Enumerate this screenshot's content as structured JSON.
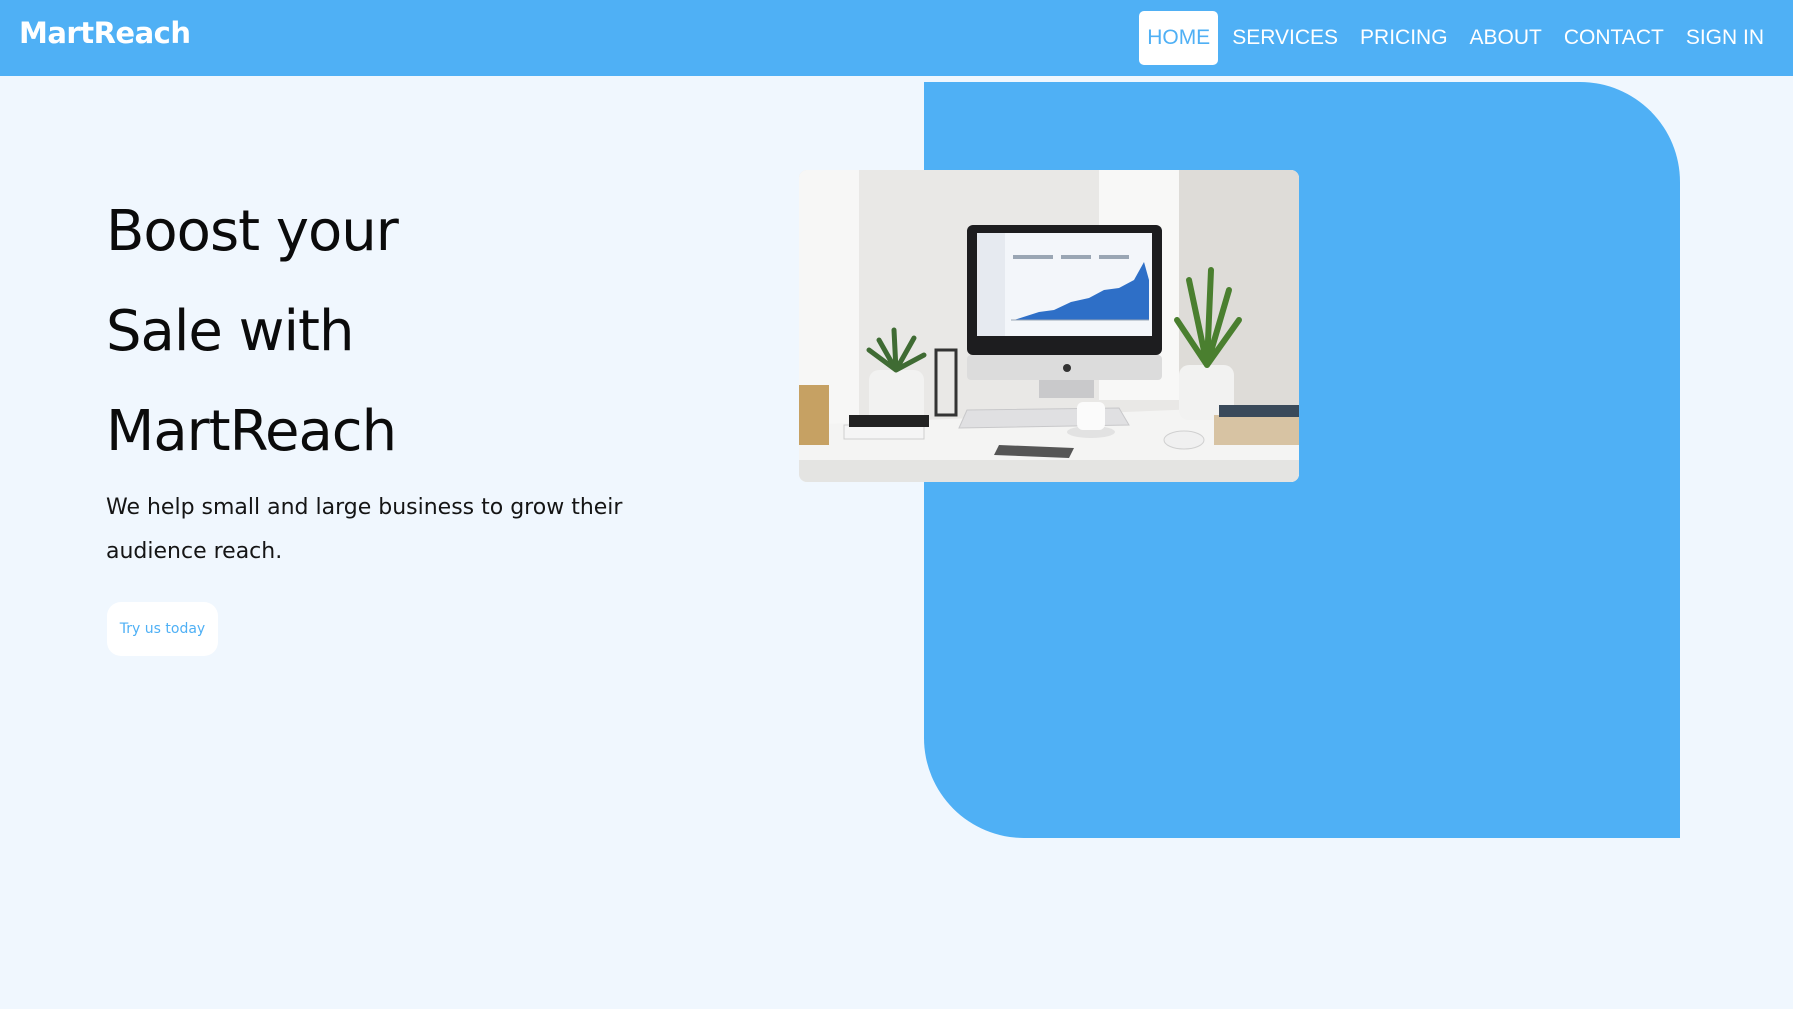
{
  "brand": {
    "name": "MartReach",
    "primary_color": "#4fb0f5",
    "background_color": "#f0f7fe"
  },
  "nav": {
    "items": [
      {
        "label": "HOME",
        "active": true
      },
      {
        "label": "SERVICES",
        "active": false
      },
      {
        "label": "PRICING",
        "active": false
      },
      {
        "label": "ABOUT",
        "active": false
      },
      {
        "label": "CONTACT",
        "active": false
      },
      {
        "label": "SIGN IN",
        "active": false
      }
    ]
  },
  "hero": {
    "headline_lines": [
      "Boost your",
      "Sale with",
      "MartReach"
    ],
    "subtext": "We help small and large business to grow their audience reach.",
    "cta_label": "Try us today",
    "image_icon": "desk-computer-analytics-photo"
  }
}
